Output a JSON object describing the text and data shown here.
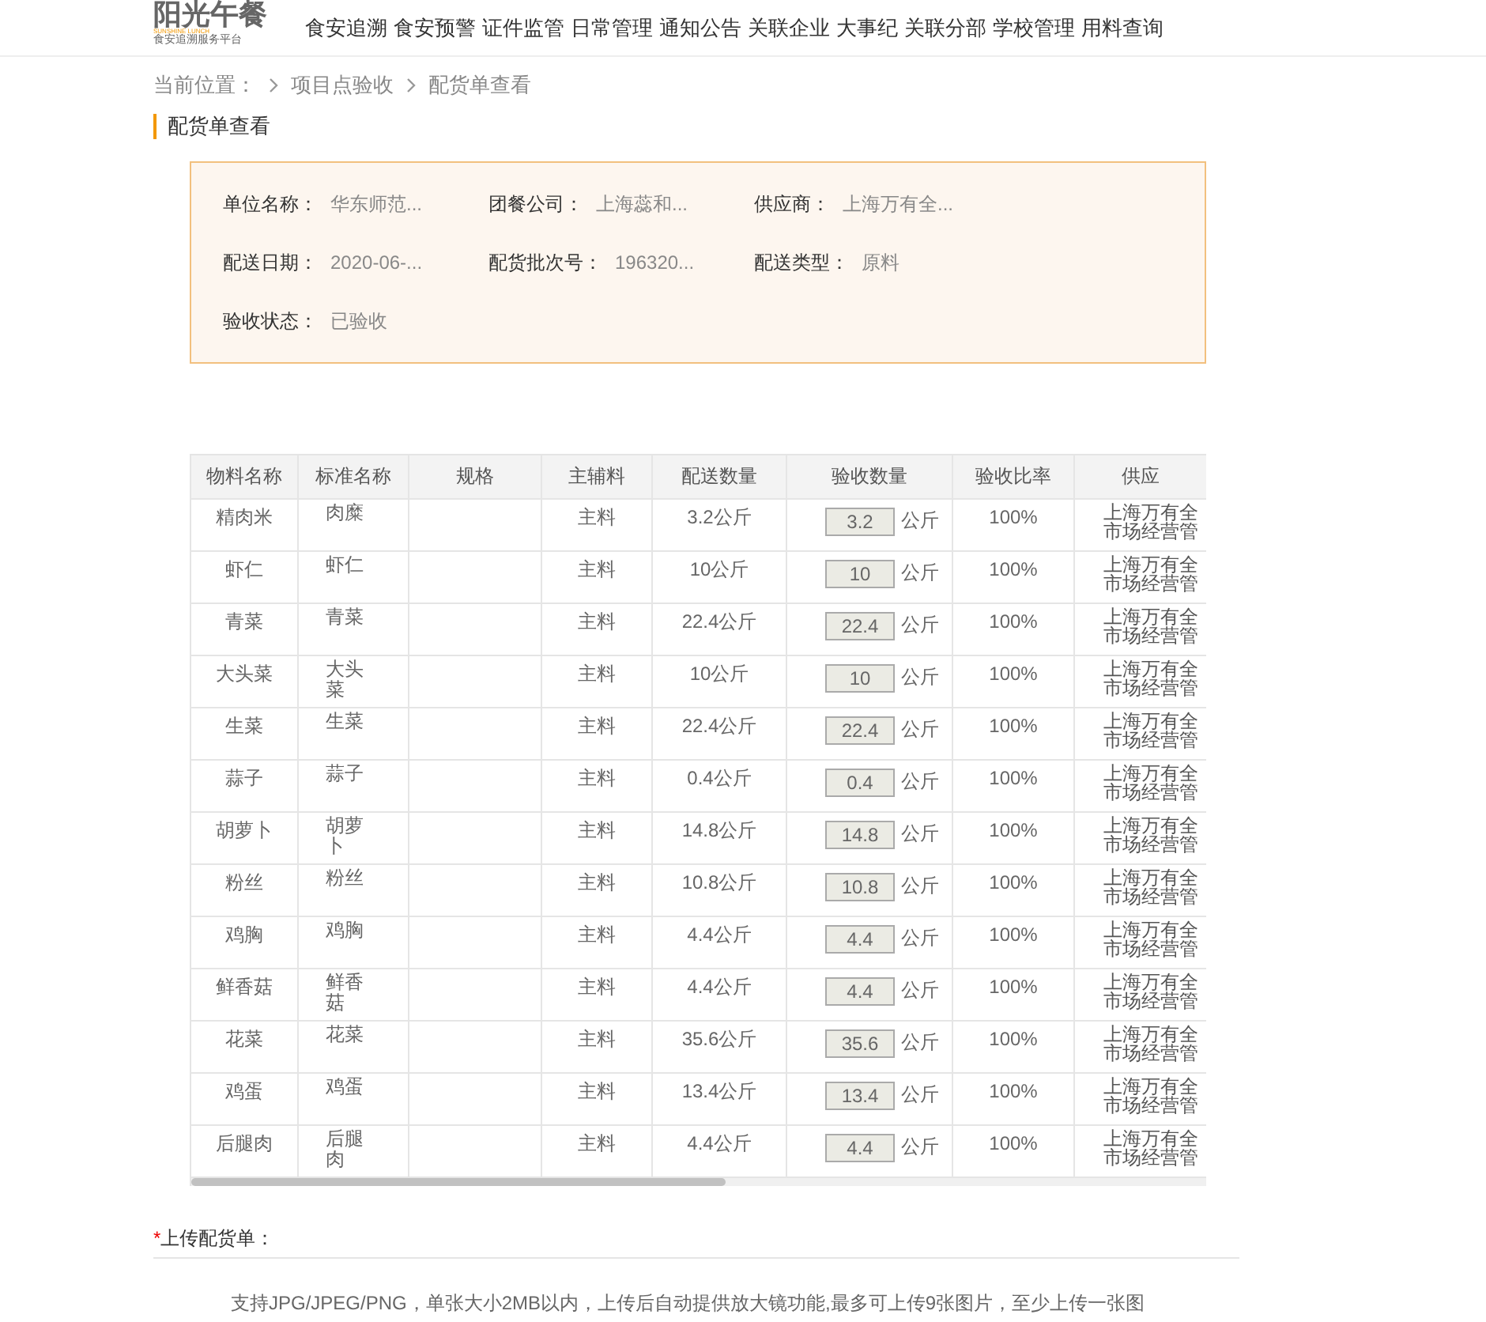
{
  "logo": {
    "title": "阳光午餐",
    "tagline": "SUNSHINE LUNCH",
    "subtitle": "食安追溯服务平台"
  },
  "nav": [
    {
      "label": "食安追溯",
      "selected": false
    },
    {
      "label": "食安预警",
      "selected": false
    },
    {
      "label": "证件监管",
      "selected": false
    },
    {
      "label": "日常管理",
      "selected": false
    },
    {
      "label": "通知公告",
      "selected": false
    },
    {
      "label": "关联企业",
      "selected": false
    },
    {
      "label": "大事纪",
      "selected": false
    },
    {
      "label": "关联分部",
      "selected": false
    },
    {
      "label": "学校管理",
      "selected": false
    },
    {
      "label": "用料查询",
      "selected": false
    }
  ],
  "breadcrumb": [
    "当前位置：",
    "项目点验收",
    "配货单查看"
  ],
  "page_title": "配货单查看",
  "info": [
    [
      {
        "label": "单位名称：",
        "value": "华东师范..."
      },
      {
        "label": "团餐公司：",
        "value": "上海蕊和..."
      },
      {
        "label": "供应商：",
        "value": "上海万有全..."
      }
    ],
    [
      {
        "label": "配送日期：",
        "value": "2020-06-..."
      },
      {
        "label": "配货批次号：",
        "value": "196320..."
      },
      {
        "label": "配送类型：",
        "value": "原料"
      }
    ],
    [
      {
        "label": "验收状态：",
        "value": "已验收"
      }
    ]
  ],
  "table": {
    "columns": [
      "物料名称",
      "标准名称",
      "规格",
      "主辅料",
      "配送数量",
      "验收数量",
      "验收比率",
      "供应"
    ],
    "rows": [
      {
        "material": "精肉米",
        "standard": "肉糜",
        "type": "主料",
        "delivered": "3.2公斤",
        "accepted": "3.2",
        "unit": "公斤",
        "ratio": "100%",
        "supplier": [
          "上海万有全",
          "市场经营管"
        ]
      },
      {
        "material": "虾仁",
        "standard": "虾仁",
        "type": "主料",
        "delivered": "10公斤",
        "accepted": "10",
        "unit": "公斤",
        "ratio": "100%",
        "supplier": [
          "上海万有全",
          "市场经营管"
        ]
      },
      {
        "material": "青菜",
        "standard": "青菜",
        "type": "主料",
        "delivered": "22.4公斤",
        "accepted": "22.4",
        "unit": "公斤",
        "ratio": "100%",
        "supplier": [
          "上海万有全",
          "市场经营管"
        ]
      },
      {
        "material": "大头菜",
        "standard": "大头菜",
        "type": "主料",
        "delivered": "10公斤",
        "accepted": "10",
        "unit": "公斤",
        "ratio": "100%",
        "supplier": [
          "上海万有全",
          "市场经营管"
        ]
      },
      {
        "material": "生菜",
        "standard": "生菜",
        "type": "主料",
        "delivered": "22.4公斤",
        "accepted": "22.4",
        "unit": "公斤",
        "ratio": "100%",
        "supplier": [
          "上海万有全",
          "市场经营管"
        ]
      },
      {
        "material": "蒜子",
        "standard": "蒜子",
        "type": "主料",
        "delivered": "0.4公斤",
        "accepted": "0.4",
        "unit": "公斤",
        "ratio": "100%",
        "supplier": [
          "上海万有全",
          "市场经营管"
        ]
      },
      {
        "material": "胡萝卜",
        "standard": "胡萝卜",
        "type": "主料",
        "delivered": "14.8公斤",
        "accepted": "14.8",
        "unit": "公斤",
        "ratio": "100%",
        "supplier": [
          "上海万有全",
          "市场经营管"
        ]
      },
      {
        "material": "粉丝",
        "standard": "粉丝",
        "type": "主料",
        "delivered": "10.8公斤",
        "accepted": "10.8",
        "unit": "公斤",
        "ratio": "100%",
        "supplier": [
          "上海万有全",
          "市场经营管"
        ]
      },
      {
        "material": "鸡胸",
        "standard": "鸡胸",
        "type": "主料",
        "delivered": "4.4公斤",
        "accepted": "4.4",
        "unit": "公斤",
        "ratio": "100%",
        "supplier": [
          "上海万有全",
          "市场经营管"
        ]
      },
      {
        "material": "鲜香菇",
        "standard": "鲜香菇",
        "type": "主料",
        "delivered": "4.4公斤",
        "accepted": "4.4",
        "unit": "公斤",
        "ratio": "100%",
        "supplier": [
          "上海万有全",
          "市场经营管"
        ]
      },
      {
        "material": "花菜",
        "standard": "花菜",
        "type": "主料",
        "delivered": "35.6公斤",
        "accepted": "35.6",
        "unit": "公斤",
        "ratio": "100%",
        "supplier": [
          "上海万有全",
          "市场经营管"
        ]
      },
      {
        "material": "鸡蛋",
        "standard": "鸡蛋",
        "type": "主料",
        "delivered": "13.4公斤",
        "accepted": "13.4",
        "unit": "公斤",
        "ratio": "100%",
        "supplier": [
          "上海万有全",
          "市场经营管"
        ]
      },
      {
        "material": "后腿肉",
        "standard": "后腿肉",
        "type": "主料",
        "delivered": "4.4公斤",
        "accepted": "4.4",
        "unit": "公斤",
        "ratio": "100%",
        "supplier": [
          "上海万有全",
          "市场经营管"
        ]
      }
    ]
  },
  "upload": {
    "required_mark": "*",
    "label": "上传配货单：",
    "hint": "支持JPG/JPEG/PNG，单张大小2MB以内，上传后自动提供放大镜功能,最多可上传9张图片，至少上传一张图"
  }
}
